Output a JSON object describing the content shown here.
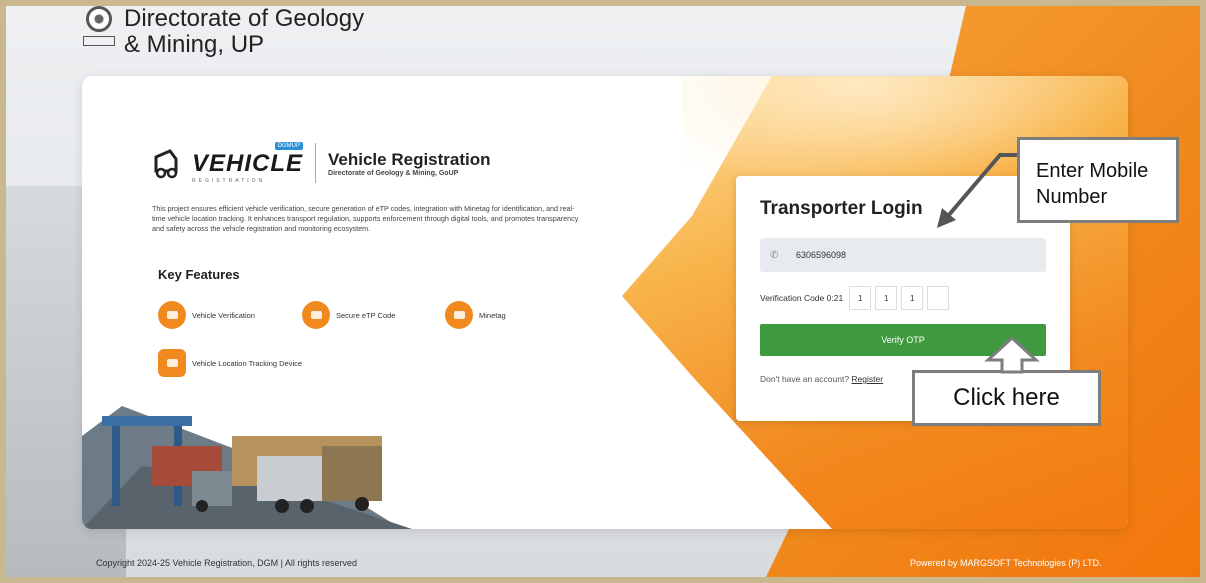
{
  "header": {
    "title_line1": "Directorate of Geology",
    "title_line2": "& Mining, UP"
  },
  "logo": {
    "tag": "DGMUP",
    "word": "VEHICLE",
    "sub": "REGISTRATION",
    "title": "Vehicle Registration",
    "subtitle": "Directorate of Geology & Mining, GoUP"
  },
  "description": "This project ensures efficient vehicle verification, secure generation of eTP codes, integration with Minetag for identification, and real-time vehicle location tracking. It enhances transport regulation, supports enforcement through digital tools, and promotes transparency and safety across the vehicle registration and monitoring ecosystem.",
  "features": {
    "heading": "Key Features",
    "items": [
      "Vehicle Verification",
      "Secure eTP Code",
      "Minetag",
      "Vehicle Location Tracking Device"
    ]
  },
  "login": {
    "title": "Transporter Login",
    "mobile_value": "6306596098",
    "otp_label": "Verification Code 0:21",
    "otp_digits": [
      "1",
      "1",
      "1",
      ""
    ],
    "verify_label": "Verify OTP",
    "account_text": "Don't have an account?",
    "register_label": "Register"
  },
  "annotations": {
    "mobile_callout": "Enter Mobile Number",
    "click_callout": "Click here"
  },
  "footer": {
    "copyright": "Copyright 2024-25 Vehicle Registration, DGM | All rights reserved",
    "powered": "Powered by MARGSOFT Technologies (P) LTD."
  }
}
